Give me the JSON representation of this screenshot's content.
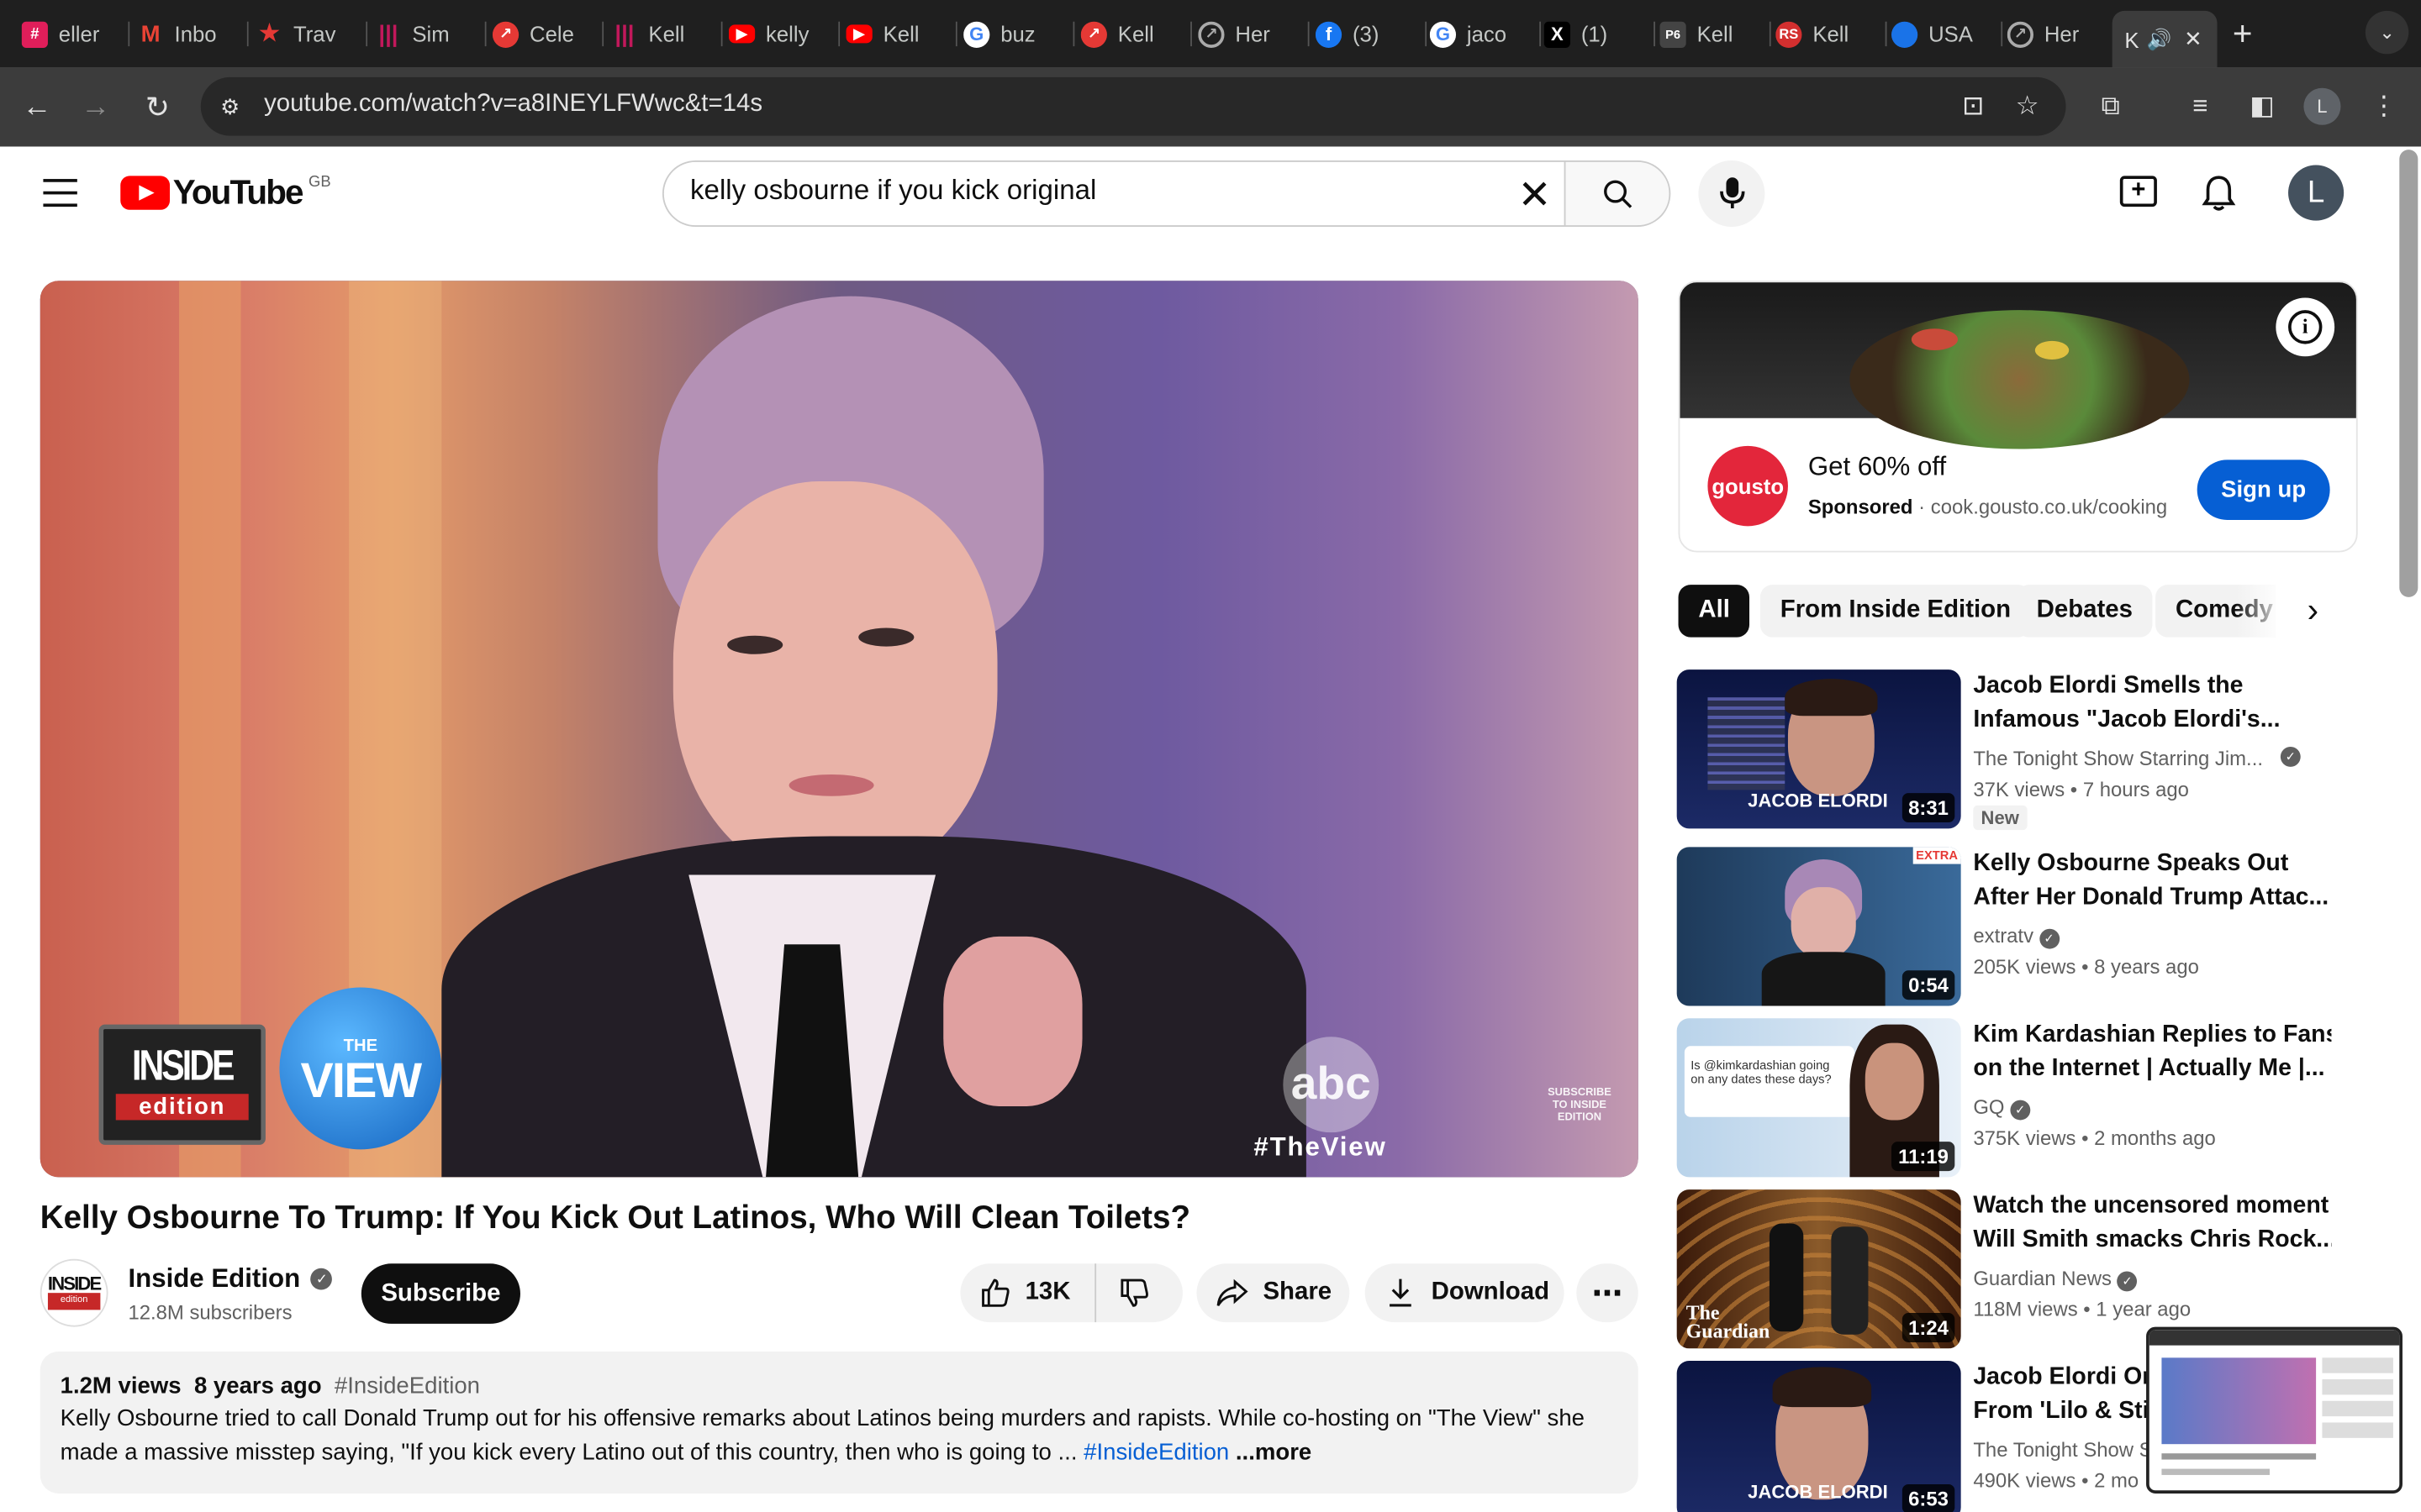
{
  "browser": {
    "tabs": [
      {
        "label": "eller",
        "icon": "slack-icon",
        "color": "#e01e5a"
      },
      {
        "label": "Inbo",
        "icon": "gmail-icon",
        "color": "#ea4335"
      },
      {
        "label": "Trav",
        "icon": "star-icon",
        "color": "#e53935"
      },
      {
        "label": "Sim",
        "icon": "bars-icon",
        "color": "#c2185b"
      },
      {
        "label": "Cele",
        "icon": "trend-icon",
        "color": "#e53935"
      },
      {
        "label": "Kell",
        "icon": "bars-icon",
        "color": "#c2185b"
      },
      {
        "label": "kelly",
        "icon": "youtube-icon",
        "color": "#ff0000"
      },
      {
        "label": "Kell",
        "icon": "youtube-icon",
        "color": "#ff0000"
      },
      {
        "label": "buz",
        "icon": "google-icon",
        "color": "#4285f4"
      },
      {
        "label": "Kell",
        "icon": "trend-icon",
        "color": "#e53935"
      },
      {
        "label": "Her",
        "icon": "compass-icon",
        "color": "#555555"
      },
      {
        "label": "(3)",
        "icon": "facebook-icon",
        "color": "#1877f2"
      },
      {
        "label": "jaco",
        "icon": "google-icon",
        "color": "#4285f4"
      },
      {
        "label": "(1)",
        "icon": "x-icon",
        "color": "#000000"
      },
      {
        "label": "Kell",
        "icon": "page-six-icon",
        "color": "#222222"
      },
      {
        "label": "Kell",
        "icon": "rs-icon",
        "color": "#d32f2f"
      },
      {
        "label": "USA",
        "icon": "globe-icon",
        "color": "#1a73e8"
      },
      {
        "label": "Her",
        "icon": "compass-icon",
        "color": "#555555"
      },
      {
        "label": "K",
        "icon": "youtube-icon",
        "color": "#ff0000"
      }
    ],
    "url": "youtube.com/watch?v=a8INEYLFWwc&t=14s",
    "profile_initial": "L"
  },
  "header": {
    "logo_text": "YouTube",
    "region": "GB",
    "search_value": "kelly osbourne if you kick original",
    "avatar_initial": "L"
  },
  "video": {
    "overlay_brand": "INSIDE",
    "overlay_brand_sub": "edition",
    "overlay_show": "VIEW",
    "overlay_show_small": "THE",
    "overlay_network": "abc",
    "overlay_hashtag": "#TheView",
    "overlay_subscribe": "SUBSCRIBE TO INSIDE EDITION",
    "title": "Kelly Osbourne To Trump: If You Kick Out Latinos, Who Will Clean Toilets?",
    "channel": "Inside Edition",
    "channel_avatar_text": "INSIDE",
    "subscribers": "12.8M subscribers",
    "subscribe_label": "Subscribe",
    "likes": "13K",
    "share_label": "Share",
    "download_label": "Download"
  },
  "description": {
    "views": "1.2M views",
    "age": "8 years ago",
    "hashtag": "#InsideEdition",
    "line1": "Kelly Osbourne tried to call Donald Trump out for his offensive remarks about Latinos being murders and rapists. While co-hosting on \"The View\" she",
    "line2": "made a massive misstep saying, \"If you kick every Latino out of this country, then who is going to ... ",
    "line2_tag": "#InsideEdition",
    "more": "...more"
  },
  "ad": {
    "brand": "gousto",
    "headline": "Get 60% off",
    "sponsored": "Sponsored",
    "domain": "cook.gousto.co.uk/cooking",
    "cta": "Sign up"
  },
  "chips": [
    "All",
    "From Inside Edition",
    "Debates",
    "Comedy"
  ],
  "recommendations": [
    {
      "title1": "Jacob Elordi Smells the",
      "title2": "Infamous \"Jacob Elordi's...",
      "channel": "The Tonight Show Starring Jim...",
      "views": "37K views",
      "age": "7 hours ago",
      "badge": "New",
      "duration": "8:31",
      "thumb_caption": "JACOB ELORDI"
    },
    {
      "title1": "Kelly Osbourne Speaks Out",
      "title2": "After Her Donald Trump Attac...",
      "channel": "extratv",
      "views": "205K views",
      "age": "8 years ago",
      "duration": "0:54",
      "thumb_caption": "EXTRA"
    },
    {
      "title1": "Kim Kardashian Replies to Fans",
      "title2": "on the Internet | Actually Me |...",
      "channel": "GQ",
      "views": "375K views",
      "age": "2 months ago",
      "duration": "11:19",
      "thumb_caption": "Is @kimkardashian going on any dates these days?"
    },
    {
      "title1": "Watch the uncensored moment",
      "title2": "Will Smith smacks Chris Rock...",
      "channel": "Guardian News",
      "views": "118M views",
      "age": "1 year ago",
      "duration": "1:24",
      "thumb_caption": "The Guardian"
    },
    {
      "title1": "Jacob Elordi Onl",
      "title2": "From 'Lilo & Stitc",
      "channel": "The Tonight Show S",
      "views": "490K views",
      "age": "2 mo",
      "duration": "6:53",
      "thumb_caption": "JACOB ELORDI"
    }
  ]
}
